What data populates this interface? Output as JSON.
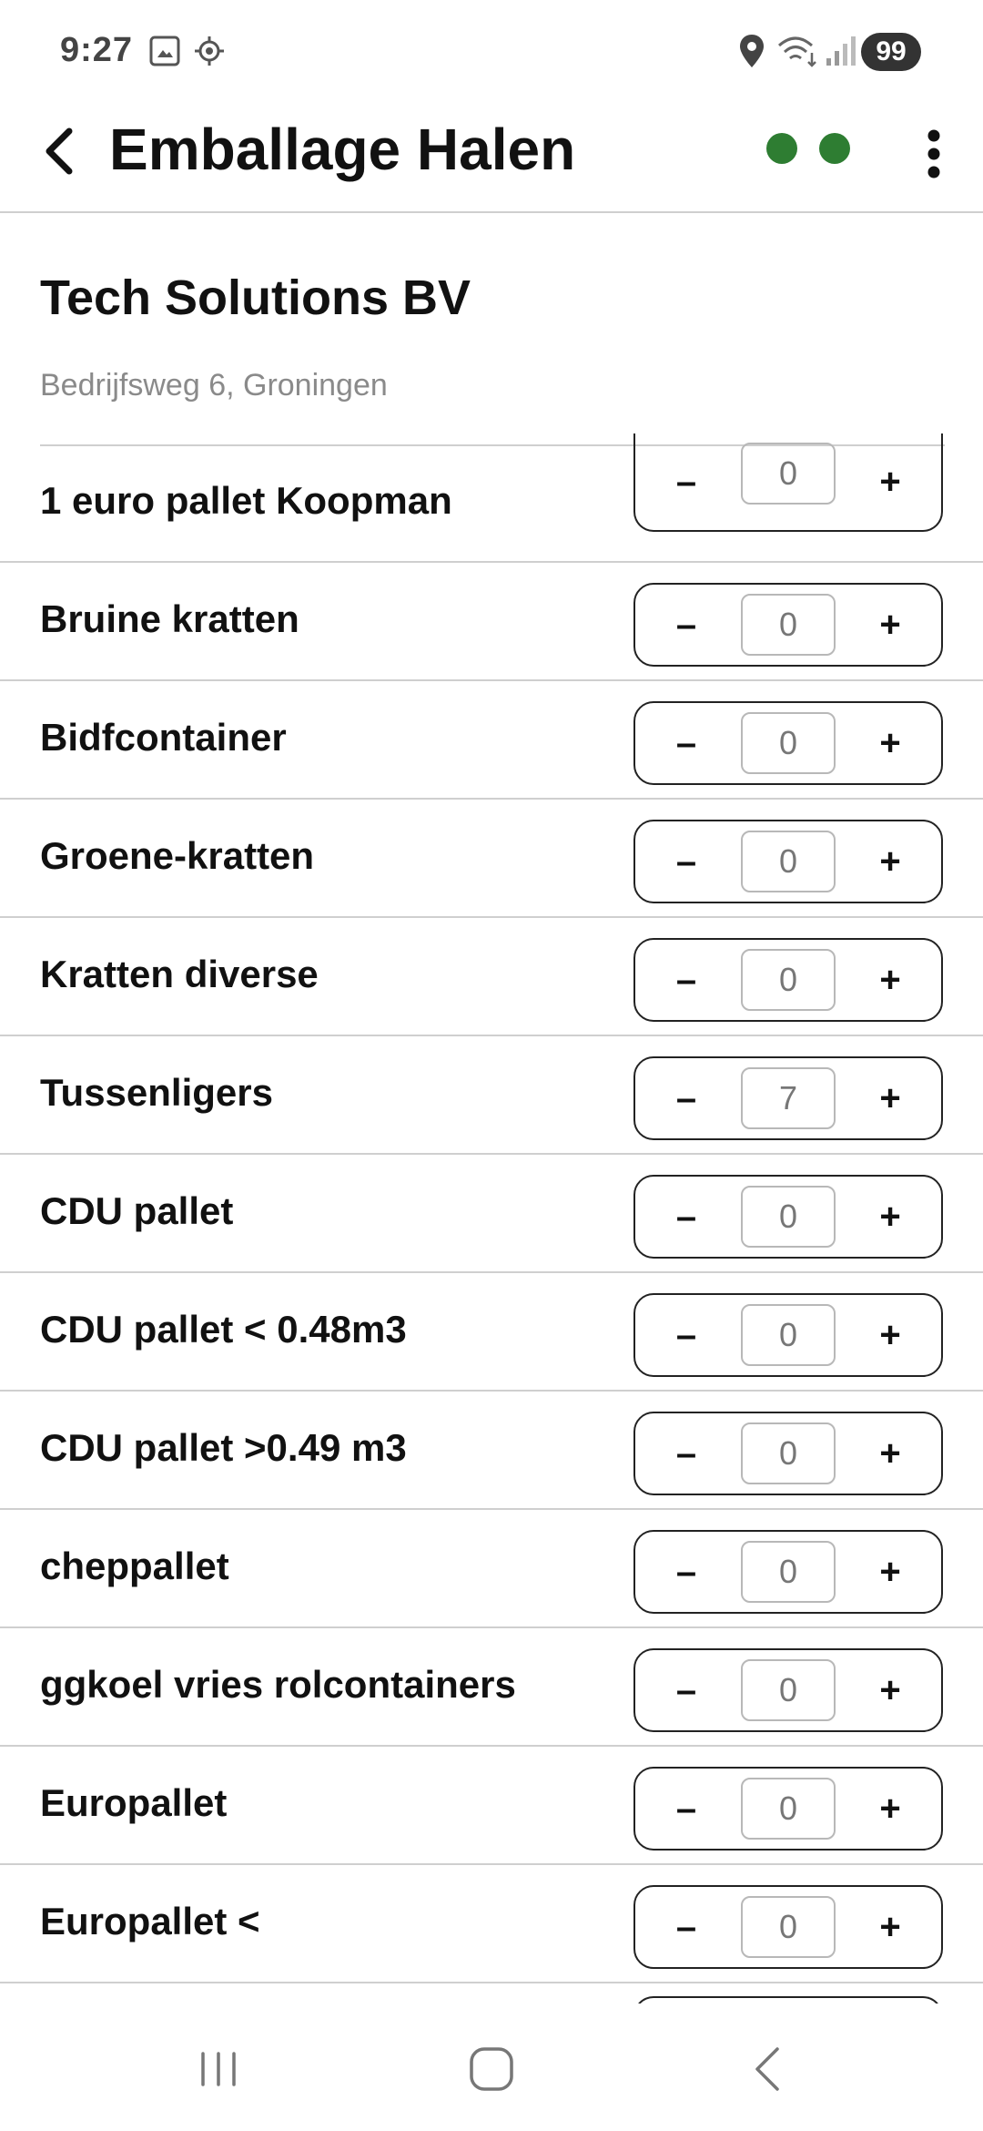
{
  "status_bar": {
    "time": "9:27",
    "icons": [
      "screenshot-icon",
      "location-target-icon",
      "location-pin-icon",
      "wifi-icon",
      "signal-icon"
    ],
    "battery": "99"
  },
  "app_bar": {
    "title": "Emballage Halen",
    "status_dot_color": "#2e7d32"
  },
  "customer": {
    "name": "Tech Solutions BV",
    "address": "Bedrijfsweg 6, Groningen"
  },
  "stepper": {
    "minus_label": "–",
    "plus_label": "+"
  },
  "items": [
    {
      "label": "1 euro pallet Koopman",
      "qty": "0"
    },
    {
      "label": "Bruine kratten",
      "qty": "0"
    },
    {
      "label": "Bidfcontainer",
      "qty": "0"
    },
    {
      "label": "Groene-kratten",
      "qty": "0"
    },
    {
      "label": "Kratten diverse",
      "qty": "0"
    },
    {
      "label": "Tussenligers",
      "qty": "7"
    },
    {
      "label": "CDU pallet",
      "qty": "0"
    },
    {
      "label": "CDU pallet < 0.48m3",
      "qty": "0"
    },
    {
      "label": "CDU pallet >0.49 m3",
      "qty": "0"
    },
    {
      "label": "cheppallet",
      "qty": "0"
    },
    {
      "label": "ggkoel vries rolcontainers",
      "qty": "0"
    },
    {
      "label": "Europallet",
      "qty": "0"
    },
    {
      "label": "Europallet <",
      "qty": "0"
    }
  ],
  "nav_bar": {
    "icons": [
      "recent-apps-icon",
      "home-icon",
      "back-nav-icon"
    ]
  }
}
